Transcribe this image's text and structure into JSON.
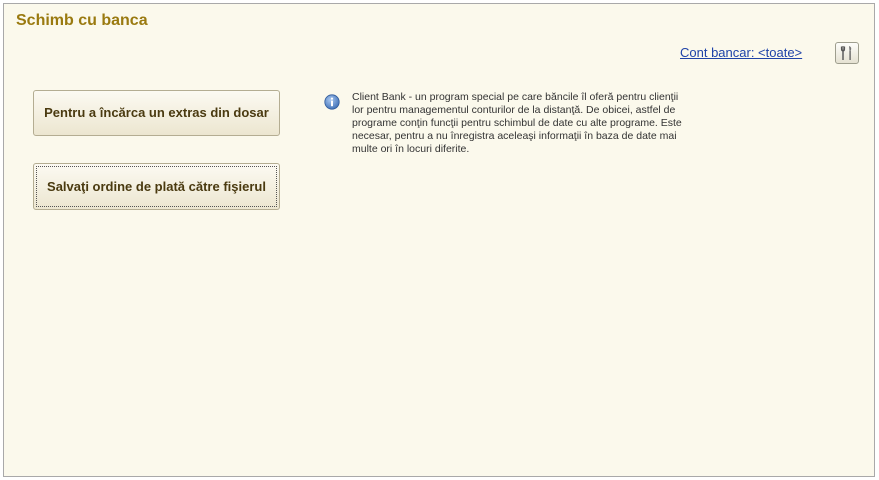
{
  "header": {
    "title": "Schimb cu banca"
  },
  "account": {
    "link_text": "Cont bancar: <toate>"
  },
  "settings": {
    "icon": "tools-icon"
  },
  "actions": {
    "load_statement": "Pentru a încărca un extras din dosar",
    "save_orders": "Salvaţi ordine de plată către fişierul"
  },
  "info": {
    "icon": "info-icon",
    "text": "Client Bank - un program special pe care băncile îl oferă pentru clienţii lor pentru managementul conturilor de la distanţă. De obicei, astfel de programe conţin funcţii pentru schimbul de date cu alte programe. Este necesar, pentru a nu înregistra aceleaşi informaţii în baza de date mai multe ori în locuri diferite."
  },
  "colors": {
    "background": "#fbf9ec",
    "title": "#9a7a10",
    "link": "#1f43a8"
  }
}
